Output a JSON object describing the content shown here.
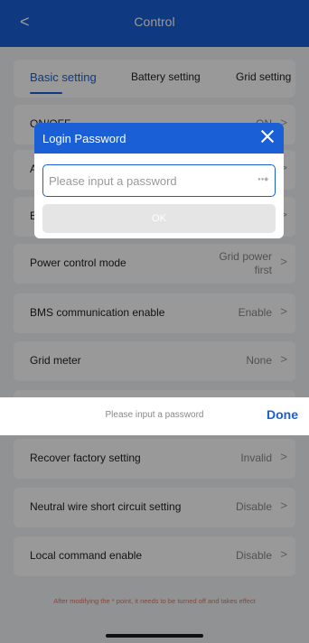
{
  "header": {
    "back_label": "<",
    "title": "Control"
  },
  "tabs": [
    {
      "label": "Basic setting",
      "active": true
    },
    {
      "label": "Battery setting",
      "active": false
    },
    {
      "label": "Grid setting",
      "active": false
    }
  ],
  "settings": {
    "rows": [
      {
        "label": "ON/OFF",
        "value": "ON"
      },
      {
        "label": "A",
        "value": ""
      },
      {
        "label": "E",
        "value": ""
      },
      {
        "label": "Power control mode",
        "value_line1": "Grid power",
        "value_line2": "first"
      },
      {
        "label": "BMS communication enable",
        "value": "Enable"
      },
      {
        "label": "Grid meter",
        "value": "None"
      },
      {
        "label": "Recover factory setting",
        "value": "Invalid"
      },
      {
        "label": "Neutral wire short circuit setting",
        "value": "Disable"
      },
      {
        "label": "Local command enable",
        "value": "Disable"
      }
    ],
    "chevron": ">"
  },
  "dialog": {
    "title": "Login Password",
    "password_placeholder": "Please input a password",
    "password_value": "",
    "ok_label": "OK"
  },
  "keyboard_bar": {
    "hint": "Please input a password",
    "done_label": "Done"
  },
  "footer_note": "After modifying the * point, it needs to be turned off and takes effect",
  "colors": {
    "accent": "#1a5fd6",
    "background": "#f2f3f5",
    "warning_text": "#d97a6a"
  }
}
